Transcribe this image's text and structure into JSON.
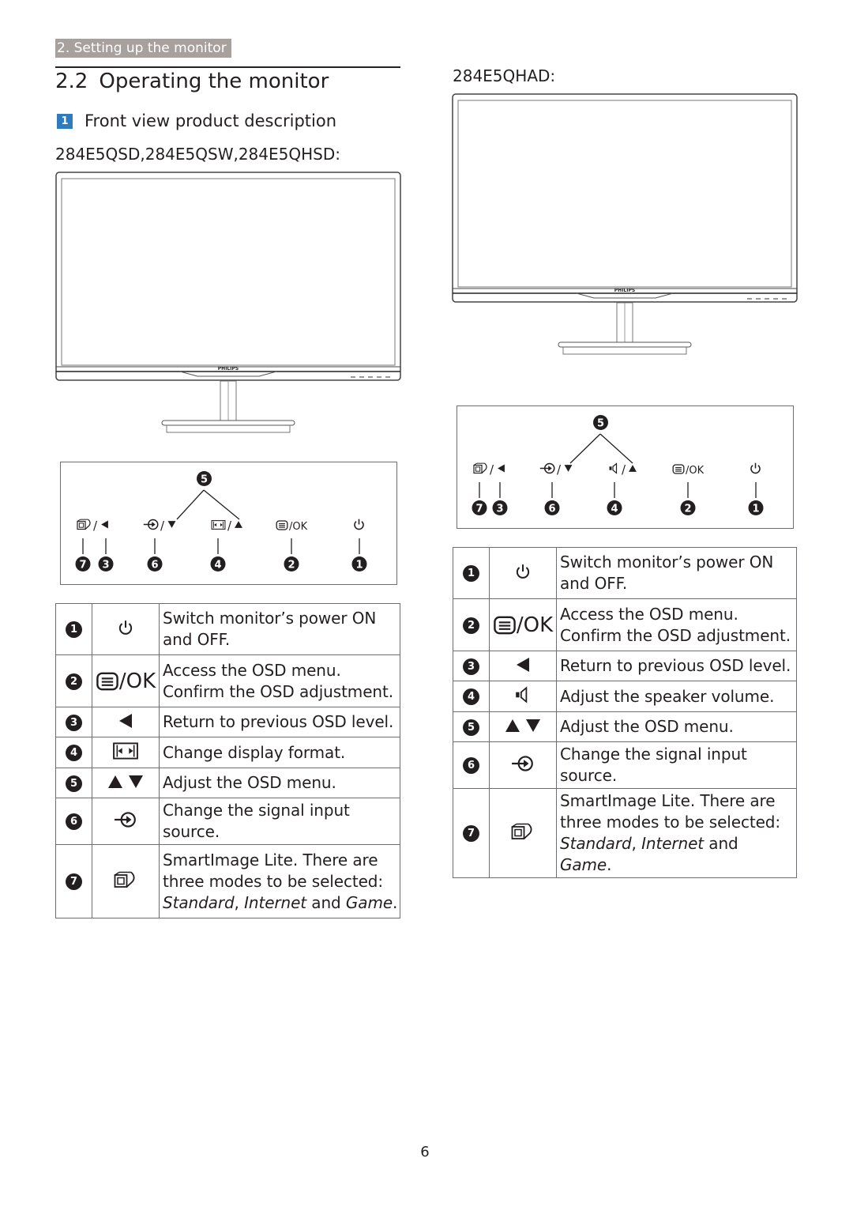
{
  "header": {
    "section_tag": "2. Setting up the monitor",
    "title_number": "2.2",
    "title_text": "Operating the monitor",
    "subsection_badge": "1",
    "subsection_title": "Front view product description"
  },
  "left": {
    "models_label": "284E5QSD,284E5QSW,284E5QHSD:",
    "monitor_brand": "PHILIPS",
    "panel": {
      "top_callout": "5",
      "buttons": [
        {
          "icon": "smartimage-icon",
          "secondary_icon": "left-triangle-icon",
          "label": "/",
          "callouts": [
            "7",
            "3"
          ]
        },
        {
          "icon": "input-icon",
          "secondary_icon": "down-triangle-icon",
          "label": "/",
          "callouts": [
            "6"
          ]
        },
        {
          "icon": "format-icon",
          "secondary_icon": "up-triangle-icon",
          "label": "/",
          "callouts": [
            "4"
          ]
        },
        {
          "icon": "menu-icon",
          "label": "/OK",
          "callouts": [
            "2"
          ]
        },
        {
          "icon": "power-icon",
          "label": "",
          "callouts": [
            "1"
          ]
        }
      ]
    },
    "rows": [
      {
        "num": "1",
        "icon": "power-icon",
        "desc": "Switch monitor’s power ON and OFF."
      },
      {
        "num": "2",
        "icon": "menu-icon",
        "icon_text": "/OK",
        "desc_line1": "Access the OSD menu.",
        "desc_line2": "Confirm the OSD adjustment."
      },
      {
        "num": "3",
        "icon": "left-triangle-icon",
        "desc": "Return to previous OSD level."
      },
      {
        "num": "4",
        "icon": "format-icon",
        "desc": "Change display format."
      },
      {
        "num": "5",
        "icon": "up-down-triangles-icon",
        "desc": "Adjust the OSD menu."
      },
      {
        "num": "6",
        "icon": "input-icon",
        "desc": "Change the signal input source."
      },
      {
        "num": "7",
        "icon": "smartimage-icon",
        "desc_plain": "SmartImage Lite. There are three modes to be selected: ",
        "mode1": "Standard",
        "sep1": ",",
        "mode2": "Internet",
        "sep2": " and ",
        "mode3": "Game",
        "end": "."
      }
    ]
  },
  "right": {
    "models_label": "284E5QHAD:",
    "monitor_brand": "PHILIPS",
    "panel": {
      "top_callout": "5",
      "buttons": [
        {
          "icon": "smartimage-icon",
          "secondary_icon": "left-triangle-icon",
          "label": "/",
          "callouts": [
            "7",
            "3"
          ]
        },
        {
          "icon": "input-icon",
          "secondary_icon": "down-triangle-icon",
          "label": "/",
          "callouts": [
            "6"
          ]
        },
        {
          "icon": "speaker-icon",
          "secondary_icon": "up-triangle-icon",
          "label": "/",
          "callouts": [
            "4"
          ]
        },
        {
          "icon": "menu-icon",
          "label": "/OK",
          "callouts": [
            "2"
          ]
        },
        {
          "icon": "power-icon",
          "label": "",
          "callouts": [
            "1"
          ]
        }
      ]
    },
    "rows": [
      {
        "num": "1",
        "icon": "power-icon",
        "desc": "Switch monitor’s power ON and OFF."
      },
      {
        "num": "2",
        "icon": "menu-icon",
        "icon_text": "/OK",
        "desc_line1": "Access the OSD menu.",
        "desc_line2": "Confirm the OSD adjustment."
      },
      {
        "num": "3",
        "icon": "left-triangle-icon",
        "desc": "Return to previous OSD level."
      },
      {
        "num": "4",
        "icon": "speaker-icon",
        "desc": "Adjust the speaker volume."
      },
      {
        "num": "5",
        "icon": "up-down-triangles-icon",
        "desc": "Adjust the OSD menu."
      },
      {
        "num": "6",
        "icon": "input-icon",
        "desc": "Change the signal input source."
      },
      {
        "num": "7",
        "icon": "smartimage-icon",
        "desc_plain": "SmartImage Lite. There are three modes to be selected: ",
        "mode1": "Standard",
        "sep1": ",",
        "mode2": "Internet",
        "sep2": " and ",
        "mode3": "Game",
        "end": "."
      }
    ]
  },
  "footer": {
    "page_number": "6"
  },
  "colors": {
    "section_tag_bg": "#a7a09d",
    "badge_blue": "#2f7bbd",
    "text": "#231f20",
    "rule": "#6d6e71"
  }
}
